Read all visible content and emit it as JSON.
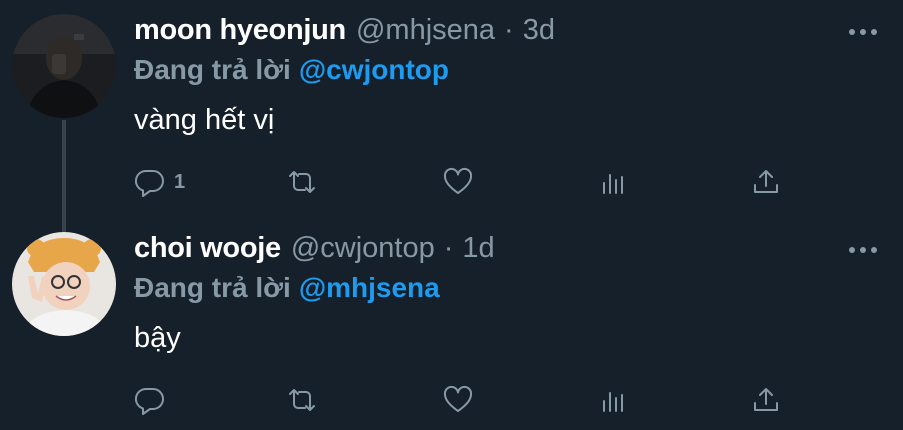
{
  "tweets": [
    {
      "display_name": "moon hyeonjun",
      "handle": "@mhjsena",
      "separator": "·",
      "time": "3d",
      "replying_prefix": "Đang trả lời",
      "replying_to": "@cwjontop",
      "text": "vàng hết vị",
      "reply_count": "1",
      "avatar": "dark-portrait-avatar"
    },
    {
      "display_name": "choi wooje",
      "handle": "@cwjontop",
      "separator": "·",
      "time": "1d",
      "replying_prefix": "Đang trả lời",
      "replying_to": "@mhjsena",
      "text": "bậy",
      "reply_count": "",
      "avatar": "peace-sign-avatar"
    }
  ],
  "icons": {
    "reply": "speech-bubble-icon",
    "retweet": "retweet-icon",
    "like": "heart-icon",
    "views": "bar-chart-icon",
    "share": "share-icon",
    "more": "more-dots-icon"
  },
  "colors": {
    "background": "#15202b",
    "primary_text": "#ffffff",
    "secondary_text": "#8899a6",
    "mention": "#1d9bf0",
    "thread_line": "#38444d"
  }
}
